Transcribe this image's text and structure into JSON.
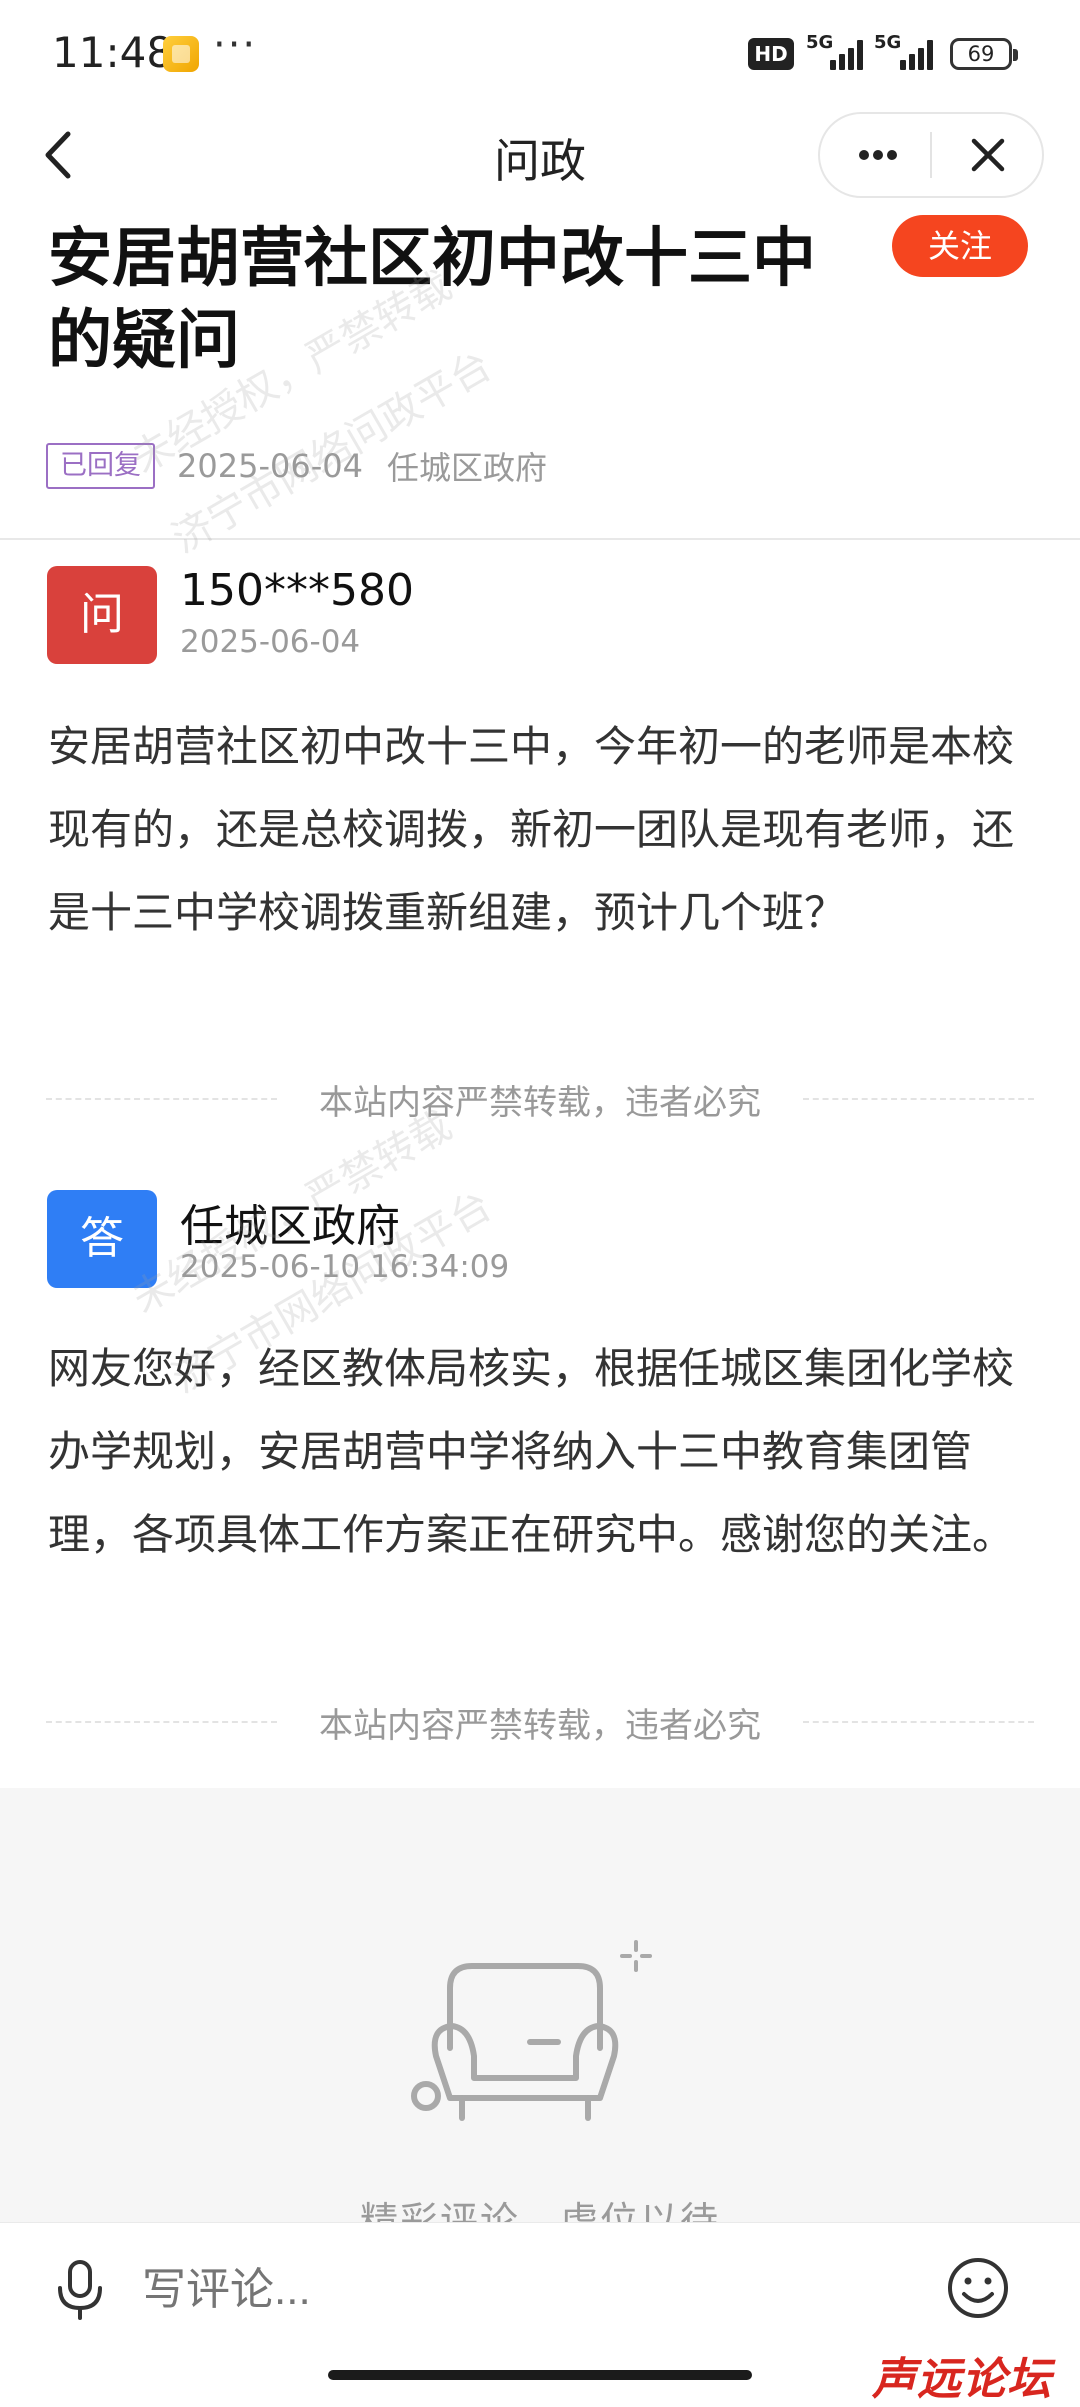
{
  "status_bar": {
    "time": "11:48",
    "more": "···",
    "hd": "HD",
    "network1": "5G",
    "network2": "5G",
    "battery": "69"
  },
  "nav": {
    "title": "问政",
    "back_icon": "chevron-left-icon",
    "more_icon": "more-icon",
    "close_icon": "close-icon"
  },
  "post": {
    "title": "安居胡营社区初中改十三中的疑问",
    "follow_label": "关注",
    "status_tag": "已回复",
    "date": "2025-06-04",
    "department": "任城区政府"
  },
  "question": {
    "avatar_text": "问",
    "author": "150***580",
    "date": "2025-06-04",
    "content": "安居胡营社区初中改十三中，今年初一的老师是本校现有的，还是总校调拨，新初一团队是现有老师，还是十三中学校调拨重新组建，预计几个班？"
  },
  "answer": {
    "avatar_text": "答",
    "author": "任城区政府",
    "date": "2025-06-10 16:34:09",
    "content": "网友您好，经区教体局核实，根据任城区集团化学校办学规划，安居胡营中学将纳入十三中教育集团管理，各项具体工作方案正在研究中。感谢您的关注。"
  },
  "copy_notice": "本站内容严禁转载，违者必究",
  "comments": {
    "empty_text": "精彩评论，虚位以待",
    "input_placeholder": "写评论..."
  },
  "watermark": {
    "line1": "未经授权，严禁转载",
    "line2": "济宁市网络问政平台"
  },
  "forum_logo": "声远论坛",
  "colors": {
    "follow": "#f5451f",
    "question_avatar": "#d9413c",
    "answer_avatar": "#2f7ef5",
    "status_tag": "#9b6fc4"
  }
}
